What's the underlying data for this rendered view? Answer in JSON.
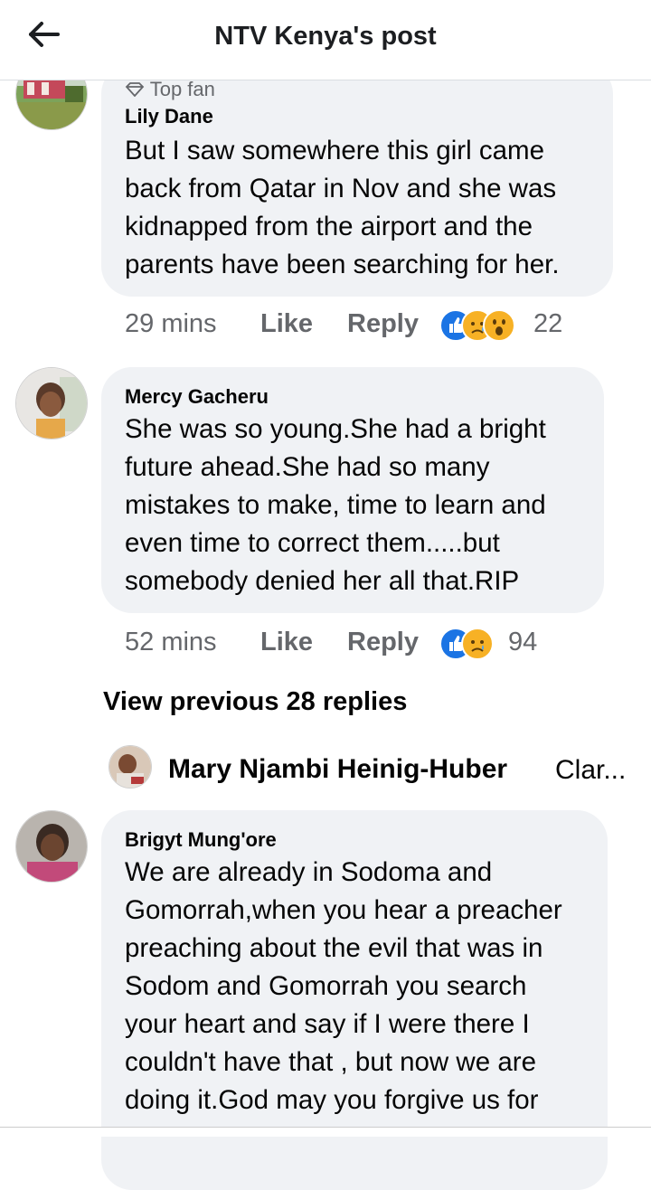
{
  "header": {
    "title": "NTV Kenya's post"
  },
  "comments": [
    {
      "badge": "Top fan",
      "name": "Lily Dane",
      "text": "But I saw somewhere this girl came back from Qatar in Nov and she was kidnapped from the airport and the parents have been searching for her.",
      "lines": [
        "But I saw somewhere this girl came",
        "back from Qatar in Nov and she was",
        "kidnapped from the airport and the",
        "parents have been searching for her."
      ],
      "time": "29 mins",
      "like": "Like",
      "reply": "Reply",
      "reactions": [
        "like",
        "sad",
        "wow"
      ],
      "reaction_count": "22"
    },
    {
      "name": "Mercy Gacheru",
      "lines": [
        "She was so young.She had a bright",
        "future ahead.She had so many",
        "mistakes to make, time to learn and",
        "even time to correct them.....but",
        "somebody denied her all that.RIP"
      ],
      "time": "52 mins",
      "like": "Like",
      "reply": "Reply",
      "reactions": [
        "like",
        "sad"
      ],
      "reaction_count": "94"
    },
    {
      "name": "Brigyt Mung'ore",
      "lines": [
        "We are already in Sodoma and",
        "Gomorrah,when you hear a preacher",
        "preaching about the evil that was in",
        "Sodom and Gomorrah you search",
        "your heart and say if I were there I",
        "couldn't have that , but now we are",
        "doing it.God may you forgive us for"
      ]
    }
  ],
  "view_previous": "View previous 28 replies",
  "reply_preview": {
    "name": "Mary Njambi Heinig-Huber",
    "snippet": "Clar..."
  },
  "colors": {
    "accent": "#1b74e4",
    "bubble": "#f0f2f5",
    "meta": "#65676b"
  }
}
